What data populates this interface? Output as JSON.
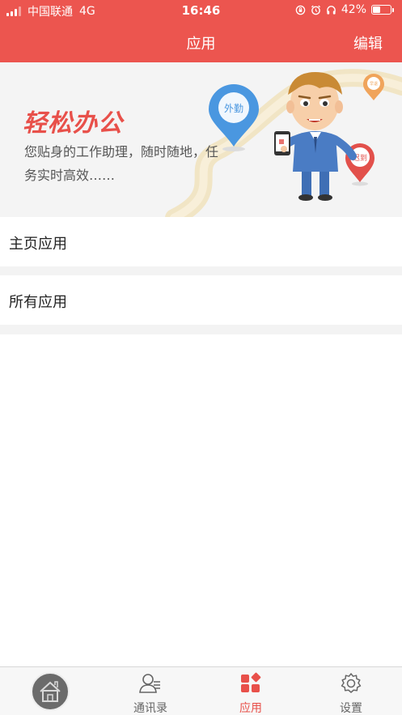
{
  "status_bar": {
    "carrier": "中国联通",
    "network": "4G",
    "time": "16:46",
    "battery": "42%",
    "battery_level": 0.42
  },
  "nav": {
    "title": "应用",
    "edit_label": "编辑"
  },
  "banner": {
    "title": "轻松办公",
    "description": "您贴身的工作助理，随时随地，任务实时高效……",
    "pins": {
      "outdoor": "外勤",
      "late": "迟到",
      "early": "早退"
    }
  },
  "sections": {
    "home_apps": "主页应用",
    "all_apps": "所有应用"
  },
  "tabbar": {
    "items": [
      {
        "label": "",
        "icon": "home-icon"
      },
      {
        "label": "通讯录",
        "icon": "contacts-icon"
      },
      {
        "label": "应用",
        "icon": "apps-icon"
      },
      {
        "label": "设置",
        "icon": "gear-icon"
      }
    ],
    "active_color": "#e8504a"
  },
  "colors": {
    "header": "#ec554f",
    "accent": "#e8504a"
  }
}
